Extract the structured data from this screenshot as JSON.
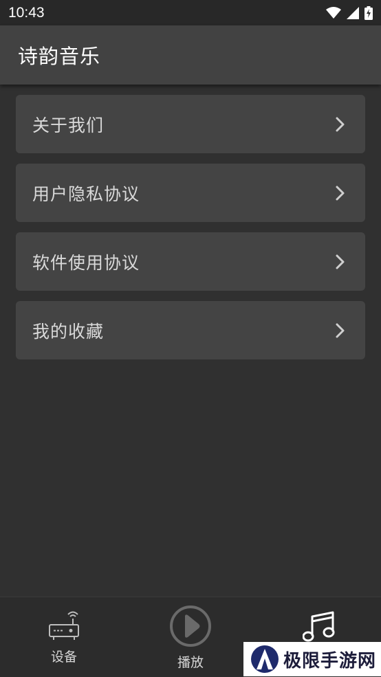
{
  "status_bar": {
    "time": "10:43",
    "icons": [
      "wifi-icon",
      "signal-icon",
      "battery-charging-icon"
    ]
  },
  "app_bar": {
    "title": "诗韵音乐"
  },
  "menu": {
    "items": [
      {
        "label": "关于我们",
        "icon": "chevron-right-icon"
      },
      {
        "label": "用户隐私协议",
        "icon": "chevron-right-icon"
      },
      {
        "label": "软件使用协议",
        "icon": "chevron-right-icon"
      },
      {
        "label": "我的收藏",
        "icon": "chevron-right-icon"
      }
    ]
  },
  "bottom_nav": {
    "items": [
      {
        "label": "设备",
        "icon": "router-icon"
      },
      {
        "label": "播放",
        "icon": "play-circle-icon"
      },
      {
        "label": "",
        "icon": "music-note-icon"
      }
    ]
  },
  "watermark": {
    "text": "极限手游网"
  },
  "colors": {
    "background": "#303030",
    "app_bar": "#424242",
    "menu_item": "#444444",
    "text": "#d9d9d9"
  }
}
